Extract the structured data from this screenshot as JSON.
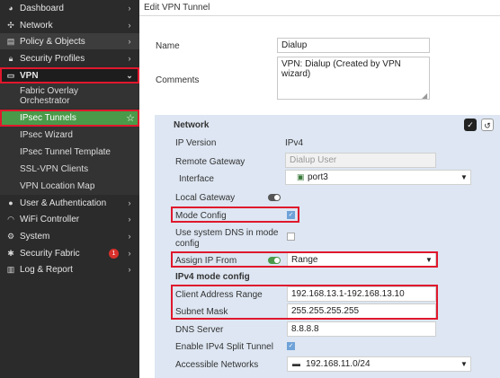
{
  "sidebar": {
    "items": [
      {
        "label": "Dashboard",
        "icon": "dashboard-icon"
      },
      {
        "label": "Network",
        "icon": "network-icon"
      },
      {
        "label": "Policy & Objects",
        "icon": "policy-icon"
      },
      {
        "label": "Security Profiles",
        "icon": "lock-icon"
      },
      {
        "label": "VPN",
        "icon": "monitor-icon"
      },
      {
        "label": "User & Authentication",
        "icon": "user-icon"
      },
      {
        "label": "WiFi Controller",
        "icon": "wifi-icon"
      },
      {
        "label": "System",
        "icon": "gear-icon"
      },
      {
        "label": "Security Fabric",
        "icon": "fabric-icon",
        "badge": "1"
      },
      {
        "label": "Log & Report",
        "icon": "chart-icon"
      }
    ],
    "vpn_sub": [
      {
        "label_line1": "Fabric Overlay",
        "label_line2": "Orchestrator"
      },
      {
        "label": "IPsec Tunnels"
      },
      {
        "label": "IPsec Wizard"
      },
      {
        "label": "IPsec Tunnel Template"
      },
      {
        "label": "SSL-VPN Clients"
      },
      {
        "label": "VPN Location Map"
      }
    ]
  },
  "main": {
    "title": "Edit VPN Tunnel",
    "name_label": "Name",
    "name_value": "Dialup",
    "comments_label": "Comments",
    "comments_value": "VPN: Dialup (Created by VPN wizard)",
    "network": {
      "heading": "Network",
      "ip_version_label": "IP Version",
      "ip_version_value": "IPv4",
      "remote_gateway_label": "Remote Gateway",
      "remote_gateway_value": "Dialup User",
      "interface_label": "Interface",
      "interface_value": "port3",
      "local_gateway_label": "Local Gateway",
      "mode_config_label": "Mode Config",
      "use_system_dns_line1": "Use system DNS in mode",
      "use_system_dns_line2": "config",
      "assign_ip_label": "Assign IP From",
      "assign_ip_value": "Range",
      "ipv4_mode_config_heading": "IPv4 mode config",
      "client_range_label": "Client Address Range",
      "client_range_value": "192.168.13.1-192.168.13.10",
      "subnet_mask_label": "Subnet Mask",
      "subnet_mask_value": "255.255.255.255",
      "dns_server_label": "DNS Server",
      "dns_server_value": "8.8.8.8",
      "split_tunnel_label": "Enable IPv4 Split Tunnel",
      "accessible_networks_label": "Accessible Networks",
      "accessible_networks_value": "192.168.11.0/24"
    }
  },
  "colors": {
    "sidebar_bg": "#2b2b2b",
    "active_green": "#4a9a4a",
    "panel_bg": "#dde6f2",
    "highlight_red": "#e0182d",
    "checkbox_blue": "#6fa2d8"
  }
}
